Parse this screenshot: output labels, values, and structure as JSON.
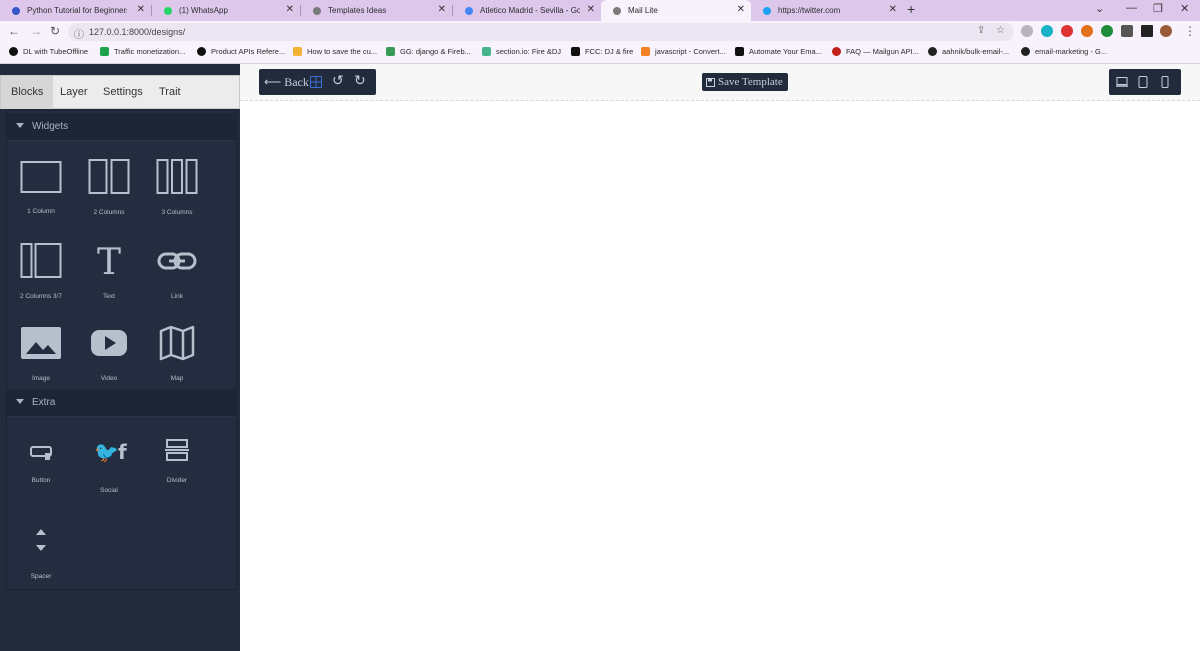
{
  "browser": {
    "tabs": [
      {
        "label": "Python Tutorial for Beginners: Le",
        "color": "#3558c9"
      },
      {
        "label": "(1) WhatsApp",
        "color": "#25d366"
      },
      {
        "label": "Templates Ideas",
        "color": "#7a7a7a"
      },
      {
        "label": "Atletico Madrid - Sevilla - Googl",
        "color": "#4285f4"
      },
      {
        "label": "Mail Lite",
        "color": "#7a7a7a"
      },
      {
        "label": "https://twitter.com",
        "color": "#1da1f2"
      }
    ],
    "url": "127.0.0.1:8000/designs/",
    "bookmarks": [
      {
        "label": "DL with TubeOffline",
        "color": "#111111"
      },
      {
        "label": "Traffic monetization...",
        "color": "#1fa34a"
      },
      {
        "label": "Product APIs Refere...",
        "color": "#111111"
      },
      {
        "label": "How to save the cu...",
        "color": "#f2b233"
      },
      {
        "label": "GG: django & Fireb...",
        "color": "#3a9b57"
      },
      {
        "label": "section.io: Fire &DJ",
        "color": "#46b58c"
      },
      {
        "label": "FCC: DJ & fire",
        "color": "#111111"
      },
      {
        "label": "javascript - Convert...",
        "color": "#f48024"
      },
      {
        "label": "Automate Your Ema...",
        "color": "#111111"
      },
      {
        "label": "FAQ — Mailgun API...",
        "color": "#c4211d"
      },
      {
        "label": "aahnik/bulk-email-...",
        "color": "#222222"
      },
      {
        "label": "email-marketing - G...",
        "color": "#222222"
      }
    ]
  },
  "panel": {
    "tabs": [
      "Blocks",
      "Layer",
      "Settings",
      "Trait"
    ],
    "active_tab": "Blocks",
    "categories": [
      {
        "title": "Widgets",
        "blocks": [
          {
            "label": "1 Column",
            "icon": "one-column-icon"
          },
          {
            "label": "2 Columns",
            "icon": "two-columns-icon"
          },
          {
            "label": "3 Columns",
            "icon": "three-columns-icon"
          },
          {
            "label": "2 Columns 3/7",
            "icon": "two-columns-3-7-icon"
          },
          {
            "label": "Text",
            "icon": "text-icon"
          },
          {
            "label": "Link",
            "icon": "link-icon"
          },
          {
            "label": "Image",
            "icon": "image-icon"
          },
          {
            "label": "Video",
            "icon": "video-icon"
          },
          {
            "label": "Map",
            "icon": "map-icon"
          }
        ]
      },
      {
        "title": "Extra",
        "blocks": [
          {
            "label": "Button",
            "icon": "button-icon"
          },
          {
            "label": "Social",
            "icon": "social-icon"
          },
          {
            "label": "Divider",
            "icon": "divider-icon"
          },
          {
            "label": "Spacer",
            "icon": "spacer-icon"
          }
        ]
      }
    ]
  },
  "toolbar": {
    "back_label": "⟵ Back",
    "save_label": "Save Template",
    "devices": [
      "desktop-icon",
      "tablet-icon",
      "mobile-icon"
    ]
  },
  "colors": {
    "panel_bg": "#222b3c",
    "tab_strip": "#ddc8ec",
    "accent_text": "#c7cedb"
  }
}
